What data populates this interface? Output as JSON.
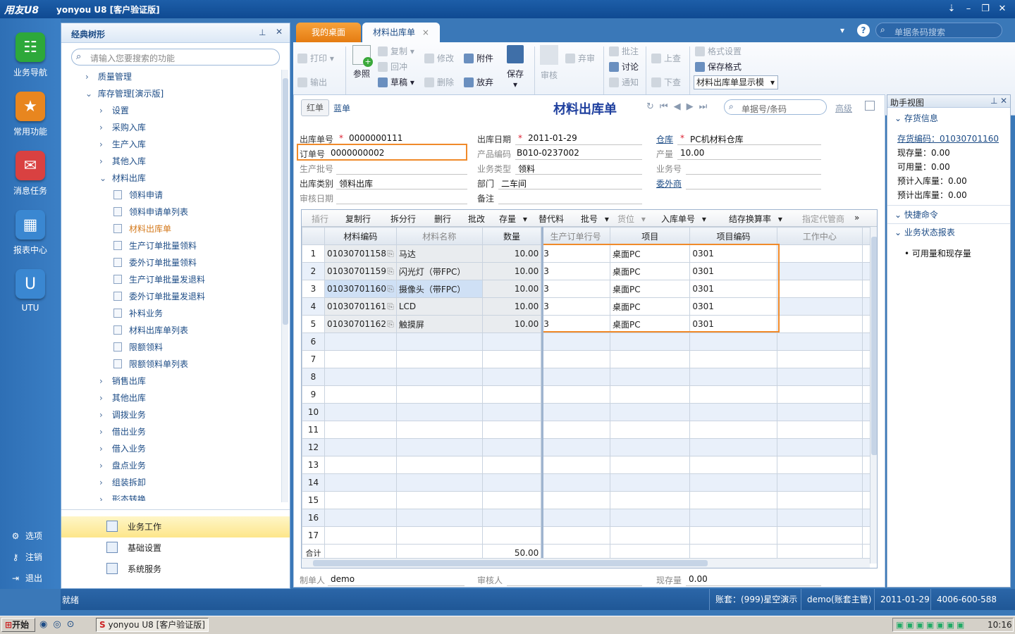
{
  "window": {
    "logo": "用友U8",
    "title": "yonyou U8 [客户验证版]"
  },
  "rail": {
    "items": [
      {
        "label": "业务导航",
        "color": "#2da83a",
        "icon": "tree-icon"
      },
      {
        "label": "常用功能",
        "color": "#e8861f",
        "icon": "star-icon"
      },
      {
        "label": "消息任务",
        "color": "#d94141",
        "icon": "mail-icon"
      },
      {
        "label": "报表中心",
        "color": "#3a87d1",
        "icon": "chart-icon"
      },
      {
        "label": "UTU",
        "color": "#3a87d1",
        "icon": "utu-icon"
      }
    ],
    "bottom": [
      {
        "label": "选项"
      },
      {
        "label": "注销"
      },
      {
        "label": "退出"
      }
    ]
  },
  "tree": {
    "title": "经典树形",
    "search_placeholder": "请输入您要搜索的功能",
    "items": [
      {
        "label": "质量管理",
        "level": 1,
        "arrow": "›"
      },
      {
        "label": "库存管理[演示版]",
        "level": 1,
        "arrow": "⌄"
      },
      {
        "label": "设置",
        "level": 2,
        "arrow": "›"
      },
      {
        "label": "采购入库",
        "level": 2,
        "arrow": "›"
      },
      {
        "label": "生产入库",
        "level": 2,
        "arrow": "›"
      },
      {
        "label": "其他入库",
        "level": 2,
        "arrow": "›"
      },
      {
        "label": "材料出库",
        "level": 2,
        "arrow": "⌄"
      },
      {
        "label": "领料申请",
        "level": 3
      },
      {
        "label": "领料申请单列表",
        "level": 3
      },
      {
        "label": "材料出库单",
        "level": 3,
        "selected": true
      },
      {
        "label": "生产订单批量领料",
        "level": 3
      },
      {
        "label": "委外订单批量领料",
        "level": 3
      },
      {
        "label": "生产订单批量发退料",
        "level": 3
      },
      {
        "label": "委外订单批量发退料",
        "level": 3
      },
      {
        "label": "补料业务",
        "level": 3
      },
      {
        "label": "材料出库单列表",
        "level": 3
      },
      {
        "label": "限额领料",
        "level": 3
      },
      {
        "label": "限额领料单列表",
        "level": 3
      },
      {
        "label": "销售出库",
        "level": 2,
        "arrow": "›"
      },
      {
        "label": "其他出库",
        "level": 2,
        "arrow": "›"
      },
      {
        "label": "调拨业务",
        "level": 2,
        "arrow": "›"
      },
      {
        "label": "借出业务",
        "level": 2,
        "arrow": "›"
      },
      {
        "label": "借入业务",
        "level": 2,
        "arrow": "›"
      },
      {
        "label": "盘点业务",
        "level": 2,
        "arrow": "›"
      },
      {
        "label": "组装拆卸",
        "level": 2,
        "arrow": "›"
      },
      {
        "label": "形态转换",
        "level": 2,
        "arrow": "›"
      }
    ],
    "bottom": [
      {
        "label": "业务工作",
        "active": true
      },
      {
        "label": "基础设置"
      },
      {
        "label": "系统服务"
      }
    ]
  },
  "tabs": [
    {
      "label": "我的桌面"
    },
    {
      "label": "材料出库单"
    }
  ],
  "barcode_search_placeholder": "单据条码搜索",
  "toolbar": {
    "print": "打印",
    "output": "输出",
    "ref": "参照",
    "copy": "复制",
    "reverse": "回冲",
    "draft": "草稿",
    "modify": "修改",
    "delete": "删除",
    "attach": "附件",
    "abandon": "放弃",
    "save": "保存",
    "audit": "审核",
    "discard": "弃审",
    "annotate": "批注",
    "discuss": "讨论",
    "notify": "通知",
    "up": "上查",
    "down": "下查",
    "format_set": "格式设置",
    "save_format": "保存格式",
    "template": "材料出库单显示模"
  },
  "form": {
    "red": "红单",
    "blue": "蓝单",
    "title": "材料出库单",
    "search_placeholder": "单据号/条码",
    "advanced": "高级",
    "fields": {
      "out_no_label": "出库单号",
      "out_no": "0000000111",
      "out_date_label": "出库日期",
      "out_date": "2011-01-29",
      "warehouse_label": "仓库",
      "warehouse": "PC机材料仓库",
      "order_no_label": "订单号",
      "order_no": "0000000002",
      "product_code_label": "产品编码",
      "product_code": "B010-0237002",
      "output_label": "产量",
      "output": "10.00",
      "batch_label": "生产批号",
      "biz_type_label": "业务类型",
      "biz_type": "领料",
      "biz_no_label": "业务号",
      "out_type_label": "出库类别",
      "out_type": "领料出库",
      "dept_label": "部门",
      "dept": "二车间",
      "outsource_label": "委外商",
      "audit_date_label": "审核日期",
      "remark_label": "备注"
    },
    "footer": {
      "maker_label": "制单人",
      "maker": "demo",
      "auditor_label": "审核人",
      "stock_label": "现存量",
      "stock": "0.00"
    }
  },
  "grid": {
    "toolbar": [
      "插行",
      "复制行",
      "拆分行",
      "删行",
      "批改",
      "存量",
      "替代料",
      "批号",
      "货位",
      "入库单号",
      "结存换算率",
      "指定代管商"
    ],
    "columns": [
      "材料编码",
      "材料名称",
      "数量",
      "生产订单行号",
      "项目",
      "项目编码",
      "工作中心"
    ],
    "rows": [
      {
        "n": "1",
        "code": "01030701158",
        "name": "马达",
        "qty": "10.00",
        "line": "3",
        "proj": "桌面PC",
        "pcode": "0301"
      },
      {
        "n": "2",
        "code": "01030701159",
        "name": "闪光灯（带FPC）",
        "qty": "10.00",
        "line": "3",
        "proj": "桌面PC",
        "pcode": "0301"
      },
      {
        "n": "3",
        "code": "01030701160",
        "name": "摄像头（带FPC）",
        "qty": "10.00",
        "line": "3",
        "proj": "桌面PC",
        "pcode": "0301"
      },
      {
        "n": "4",
        "code": "01030701161",
        "name": "LCD",
        "qty": "10.00",
        "line": "3",
        "proj": "桌面PC",
        "pcode": "0301"
      },
      {
        "n": "5",
        "code": "01030701162",
        "name": "触摸屏",
        "qty": "10.00",
        "line": "3",
        "proj": "桌面PC",
        "pcode": "0301"
      }
    ],
    "empty_rows": [
      "6",
      "7",
      "8",
      "9",
      "10",
      "11",
      "12",
      "13",
      "14",
      "15",
      "16",
      "17"
    ],
    "total_label": "合计",
    "total_qty": "50.00"
  },
  "helper": {
    "title": "助手视图",
    "sec1": "存货信息",
    "code_label": "存货编码：01030701160",
    "lines": [
      "现存量：0.00",
      "可用量：0.00",
      "预计入库量：0.00",
      "预计出库量：0.00"
    ],
    "sec2": "快捷命令",
    "sec3": "业务状态报表",
    "report": "可用量和现存量"
  },
  "status": {
    "ready": "就绪",
    "account": "账套：(999)星空演示",
    "user": "demo(账套主管)",
    "date": "2011-01-29",
    "phone": "4006-600-588"
  },
  "taskbar": {
    "start": "开始",
    "task": "yonyou U8 [客户验证版]",
    "time": "10:16"
  }
}
